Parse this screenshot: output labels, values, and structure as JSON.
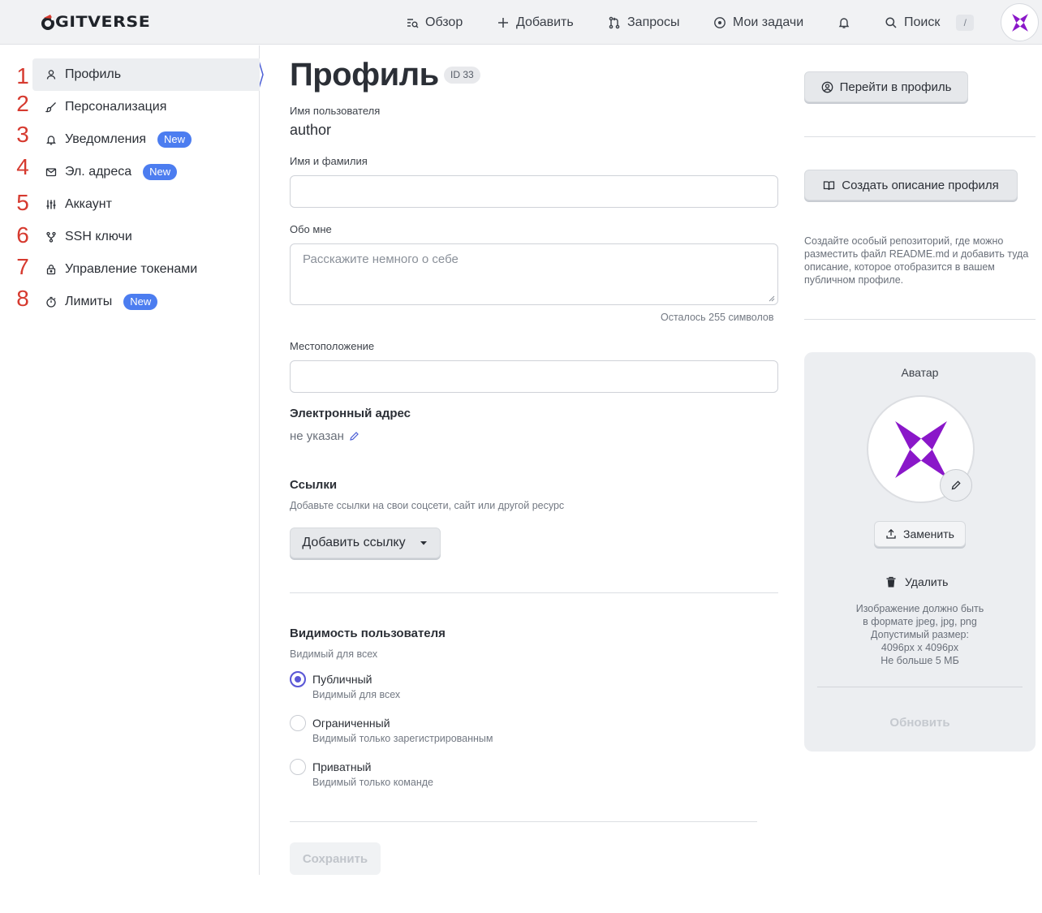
{
  "header": {
    "logo_text": "GITVERSE",
    "nav": [
      {
        "label": "Обзор",
        "icon": "search-list-icon"
      },
      {
        "label": "Добавить",
        "icon": "plus-icon"
      },
      {
        "label": "Запросы",
        "icon": "pull-request-icon"
      },
      {
        "label": "Мои задачи",
        "icon": "issue-circle-icon"
      },
      {
        "label": "",
        "icon": "bell-icon"
      },
      {
        "label": "Поиск",
        "icon": "search-icon"
      }
    ],
    "search_shortcut": "/"
  },
  "sidebar": {
    "items": [
      {
        "marker": "1",
        "label": "Профиль",
        "badge": "",
        "icon": "user-icon",
        "active": true
      },
      {
        "marker": "2",
        "label": "Персонализация",
        "badge": "",
        "icon": "brush-icon"
      },
      {
        "marker": "3",
        "label": "Уведомления",
        "badge": "New",
        "icon": "bell-icon"
      },
      {
        "marker": "4",
        "label": "Эл. адреса",
        "badge": "New",
        "icon": "mail-icon"
      },
      {
        "marker": "5",
        "label": "Аккаунт",
        "badge": "",
        "icon": "sliders-icon"
      },
      {
        "marker": "6",
        "label": "SSH ключи",
        "badge": "",
        "icon": "key-branch-icon"
      },
      {
        "marker": "7",
        "label": "Управление токенами",
        "badge": "",
        "icon": "lock-icon"
      },
      {
        "marker": "8",
        "label": "Лимиты",
        "badge": "New",
        "icon": "stopwatch-icon"
      }
    ]
  },
  "main": {
    "title": "Профиль",
    "id_chip": "ID 33",
    "username_label": "Имя пользователя",
    "username_value": "author",
    "fullname_label": "Имя и фамилия",
    "fullname_value": "",
    "about_label": "Обо мне",
    "about_placeholder": "Расскажите немного о себе",
    "about_counter": "Осталось 255 символов",
    "location_label": "Местоположение",
    "location_value": "",
    "email_title": "Электронный адрес",
    "email_value": "не указан",
    "links_title": "Ссылки",
    "links_hint": "Добавьте ссылки на свои соцсети, сайт или другой ресурс",
    "add_link_button": "Добавить ссылку",
    "visibility_title": "Видимость пользователя",
    "visibility_current": "Видимый для всех",
    "visibility_options": [
      {
        "title": "Публичный",
        "sub": "Видимый для всех",
        "selected": true
      },
      {
        "title": "Ограниченный",
        "sub": "Видимый только зарегистрированным",
        "selected": false
      },
      {
        "title": "Приватный",
        "sub": "Видимый только команде",
        "selected": false
      }
    ],
    "save_button": "Сохранить"
  },
  "right": {
    "go_profile_button": "Перейти в профиль",
    "create_desc_button": "Создать описание профиля",
    "create_desc_text": "Создайте особый репозиторий, где можно разместить файл README.md и добавить туда описание, которое отобразится в вашем публичном профиле.",
    "avatar_title": "Аватар",
    "replace_button": "Заменить",
    "delete_button": "Удалить",
    "avatar_rules": [
      "Изображение должно быть",
      "в формате jpeg, jpg, png",
      "Допустимый размер:",
      "4096px x 4096px",
      "Не больше 5 МБ"
    ],
    "update_button": "Обновить"
  },
  "colors": {
    "accent": "#5b58d6",
    "badge": "#4c7df0",
    "avatar_purple": "#8a17c9",
    "marker_red": "#d63a2f"
  }
}
